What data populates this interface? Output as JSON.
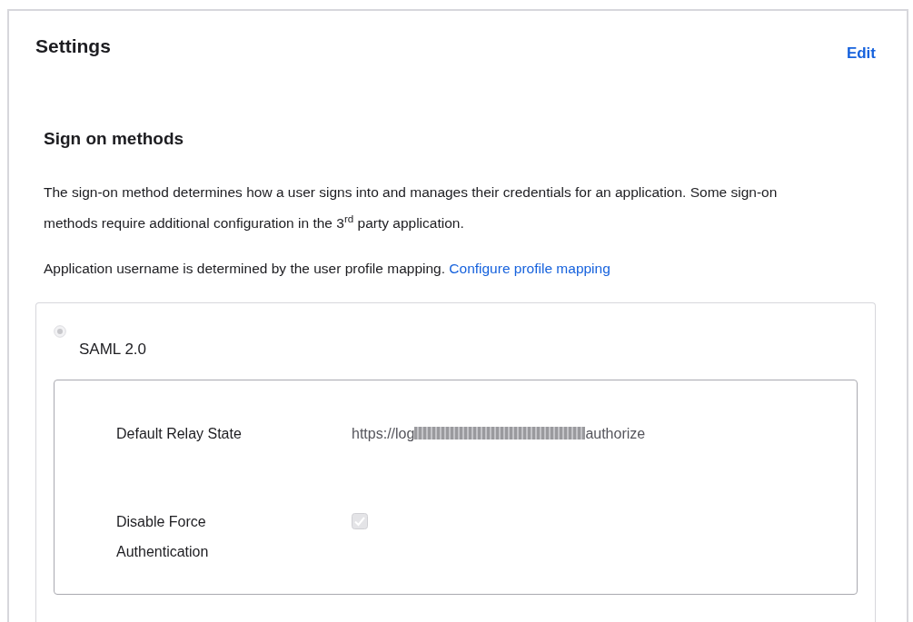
{
  "title": "Settings",
  "edit_link": "Edit",
  "section": {
    "heading": "Sign on methods",
    "paragraphs": [
      {
        "text": "The sign-on method determines how a user signs into and manages their credentials for an application. Some sign-on methods require additional configuration in the 3$^{rd}$ party application."
      },
      {
        "text": "Application username is determined by the user profile mapping.",
        "link": "Configure profile mapping"
      }
    ]
  },
  "method": {
    "label": "SAML 2.0",
    "selected": true,
    "disabled": true,
    "fields": [
      {
        "kind": "text",
        "label": "Default Relay State",
        "value_start": "https://log",
        "value_end": "authorize",
        "redacted": true
      },
      {
        "kind": "checkbox",
        "label": "Disable Force Authentication",
        "checked": true,
        "disabled": true
      }
    ]
  }
}
